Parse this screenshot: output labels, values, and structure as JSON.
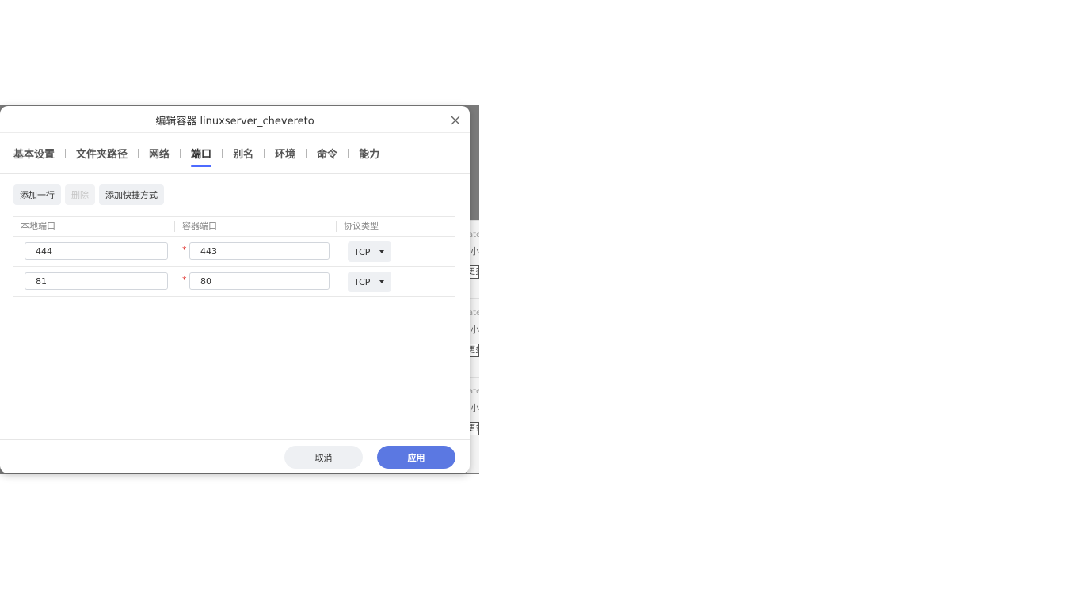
{
  "dialog": {
    "title": "编辑容器 linuxserver_chevereto"
  },
  "tabs": [
    {
      "label": "基本设置",
      "active": false
    },
    {
      "label": "文件夹路径",
      "active": false
    },
    {
      "label": "网络",
      "active": false
    },
    {
      "label": "端口",
      "active": true
    },
    {
      "label": "别名",
      "active": false
    },
    {
      "label": "环境",
      "active": false
    },
    {
      "label": "命令",
      "active": false
    },
    {
      "label": "能力",
      "active": false
    }
  ],
  "toolbar": {
    "add_row": "添加一行",
    "delete": "删除",
    "add_shortcut": "添加快捷方式"
  },
  "table": {
    "headers": [
      "本地端口",
      "容器端口",
      "协议类型"
    ],
    "rows": [
      {
        "local_port": "444",
        "container_port": "443",
        "protocol": "TCP"
      },
      {
        "local_port": "81",
        "container_port": "80",
        "protocol": "TCP"
      }
    ],
    "required_mark": "*"
  },
  "footer": {
    "cancel": "取消",
    "apply": "应用"
  },
  "background": {
    "cards": [
      {
        "line1": "ate",
        "line2": "小",
        "line3": "更多"
      },
      {
        "line1": "ate",
        "line2": "小",
        "line3": "更多"
      },
      {
        "line1": "ate",
        "line2": "小",
        "line3": "更多"
      }
    ]
  },
  "colors": {
    "accent": "#5b78e2",
    "tab_underline": "#4d6bff",
    "required": "#e0312c",
    "overlay": "#7b7b7b"
  }
}
